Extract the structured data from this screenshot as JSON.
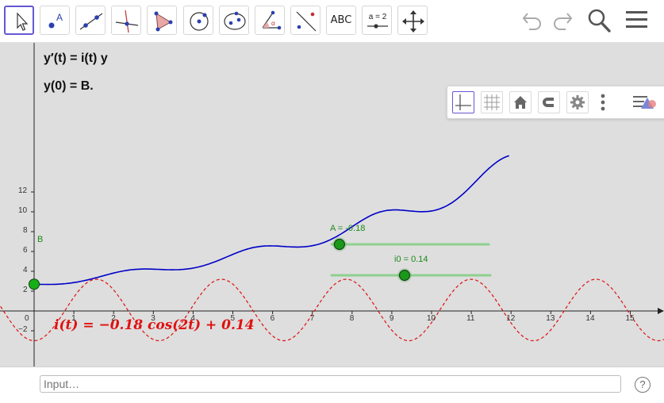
{
  "toolbar": {
    "tools": [
      {
        "name": "move-tool",
        "icon": "arrow-cursor-icon"
      },
      {
        "name": "point-tool",
        "icon": "point-icon"
      },
      {
        "name": "line-tool",
        "icon": "line-through-points-icon"
      },
      {
        "name": "perpendicular-tool",
        "icon": "perpendicular-line-icon"
      },
      {
        "name": "polygon-tool",
        "icon": "polygon-icon"
      },
      {
        "name": "circle-tool",
        "icon": "circle-center-point-icon"
      },
      {
        "name": "ellipse-tool",
        "icon": "ellipse-icon"
      },
      {
        "name": "angle-tool",
        "icon": "angle-icon"
      },
      {
        "name": "reflect-tool",
        "icon": "reflect-about-line-icon"
      },
      {
        "name": "text-tool",
        "icon": "text-icon",
        "label": "ABC"
      },
      {
        "name": "slider-tool",
        "icon": "slider-icon",
        "label": "a = 2"
      },
      {
        "name": "move-graphics-tool",
        "icon": "move-graphics-view-icon"
      }
    ],
    "right_icons": [
      "undo-icon",
      "redo-icon",
      "search-icon",
      "menu-icon"
    ]
  },
  "stylebar": {
    "icons": [
      "axes-icon",
      "grid-icon",
      "home-icon",
      "magnet-icon",
      "gear-icon",
      "more-vertical-icon",
      "toggle-style-bar-icon"
    ]
  },
  "algebra": {
    "ode_line": "y′(t) = i(t) y",
    "initial_line": "y(0) = B."
  },
  "function_label": "i(t) = −0.18 cos(2t) + 0.14",
  "point_label": "B",
  "sliders": [
    {
      "name": "A",
      "label": "A = -0.18",
      "value": -0.18
    },
    {
      "name": "i0",
      "label": "i0 = 0.14",
      "value": 0.14
    }
  ],
  "axes": {
    "x_ticks": [
      "0",
      "1",
      "2",
      "3",
      "4",
      "5",
      "6",
      "7",
      "8",
      "9",
      "10",
      "11",
      "12",
      "13",
      "14",
      "15"
    ],
    "y_ticks": [
      "−2",
      "2",
      "4",
      "6",
      "8",
      "10",
      "12"
    ]
  },
  "colors": {
    "solution_curve": "#0000c8",
    "coefficient_curve": "#e01010",
    "slider_green": "#1a8a1a",
    "canvas_bg": "#dedede"
  },
  "input": {
    "placeholder": "Input…"
  },
  "help_glyph": "?"
}
